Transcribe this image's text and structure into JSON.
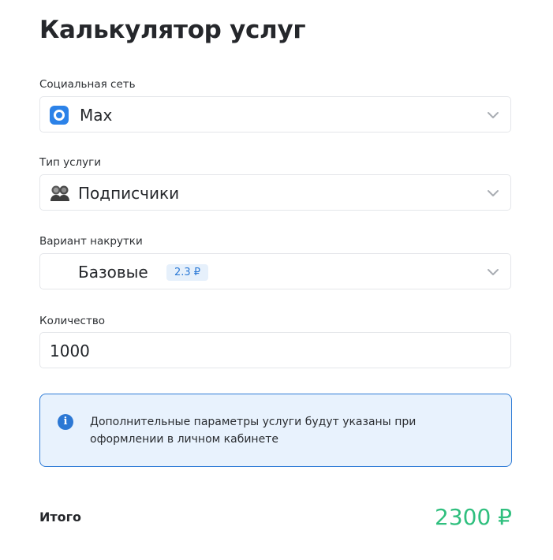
{
  "page": {
    "title": "Калькулятор услуг"
  },
  "network": {
    "label": "Социальная сеть",
    "value": "Max",
    "icon": "max-logo-icon",
    "icon_color": "#2c82e8"
  },
  "service_type": {
    "label": "Тип услуги",
    "value": "Подписчики",
    "icon": "subscribers-icon"
  },
  "variant": {
    "label": "Вариант накрутки",
    "value": "Базовые",
    "price_badge": "2.3 ₽"
  },
  "quantity": {
    "label": "Количество",
    "value": "1000"
  },
  "info": {
    "icon": "info-icon",
    "text": "Дополнительные параметры услуги будут указаны при оформлении в личном кабинете"
  },
  "total": {
    "label": "Итого",
    "value": "2300 ₽",
    "color": "#2fbf7e"
  }
}
